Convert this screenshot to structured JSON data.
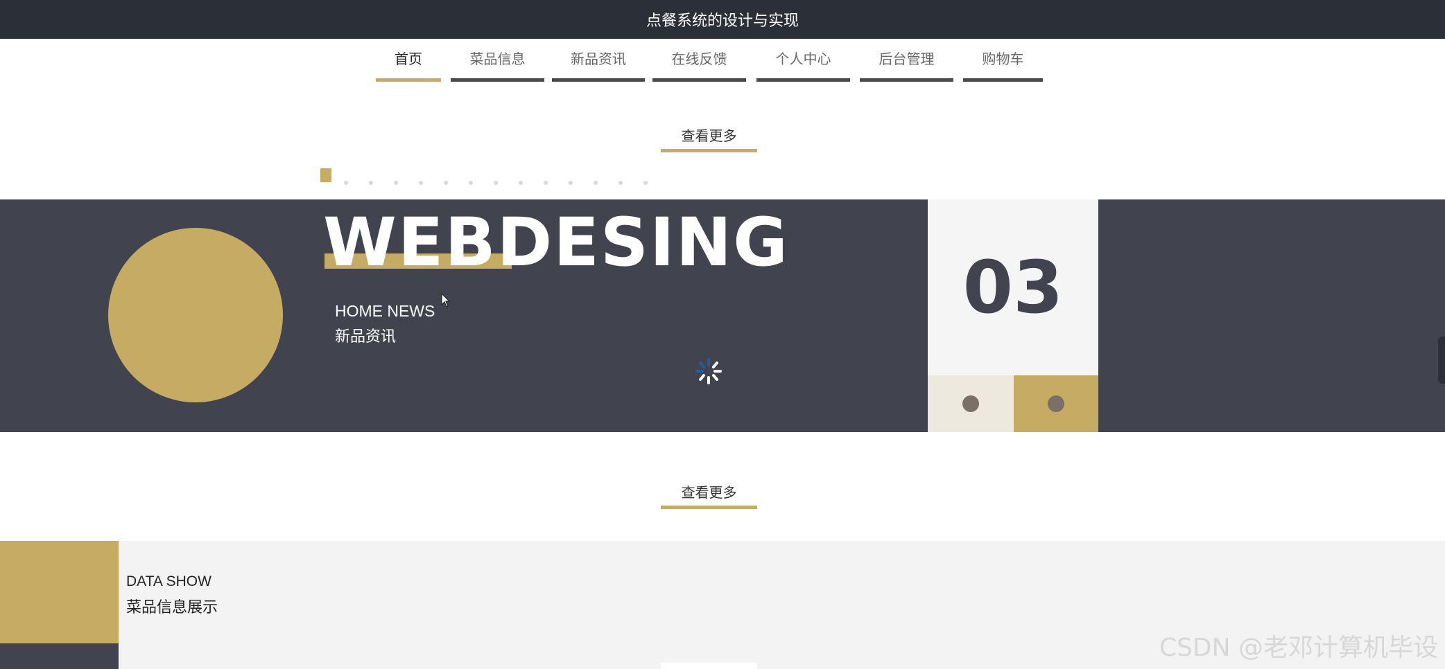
{
  "header": {
    "title": "点餐系统的设计与实现"
  },
  "nav": {
    "items": [
      {
        "label": "首页",
        "active": true
      },
      {
        "label": "菜品信息",
        "active": false
      },
      {
        "label": "新品资讯",
        "active": false
      },
      {
        "label": "在线反馈",
        "active": false
      },
      {
        "label": "个人中心",
        "active": false
      },
      {
        "label": "后台管理",
        "active": false
      },
      {
        "label": "购物车",
        "active": false
      }
    ]
  },
  "news_section": {
    "more_label": "查看更多",
    "banner_word": "WEBDESING",
    "title_en": "HOME NEWS",
    "title_cn": "新品资讯",
    "counter": "03",
    "loading_icon": "spinner-icon"
  },
  "data_section": {
    "more_label": "查看更多",
    "title_en": "DATA SHOW",
    "title_cn": "菜品信息展示"
  },
  "watermark": {
    "text": "CSDN @老邓计算机毕设"
  },
  "colors": {
    "accent": "#c6ac62",
    "dark": "#41444f",
    "topbar": "#2b2f37"
  }
}
